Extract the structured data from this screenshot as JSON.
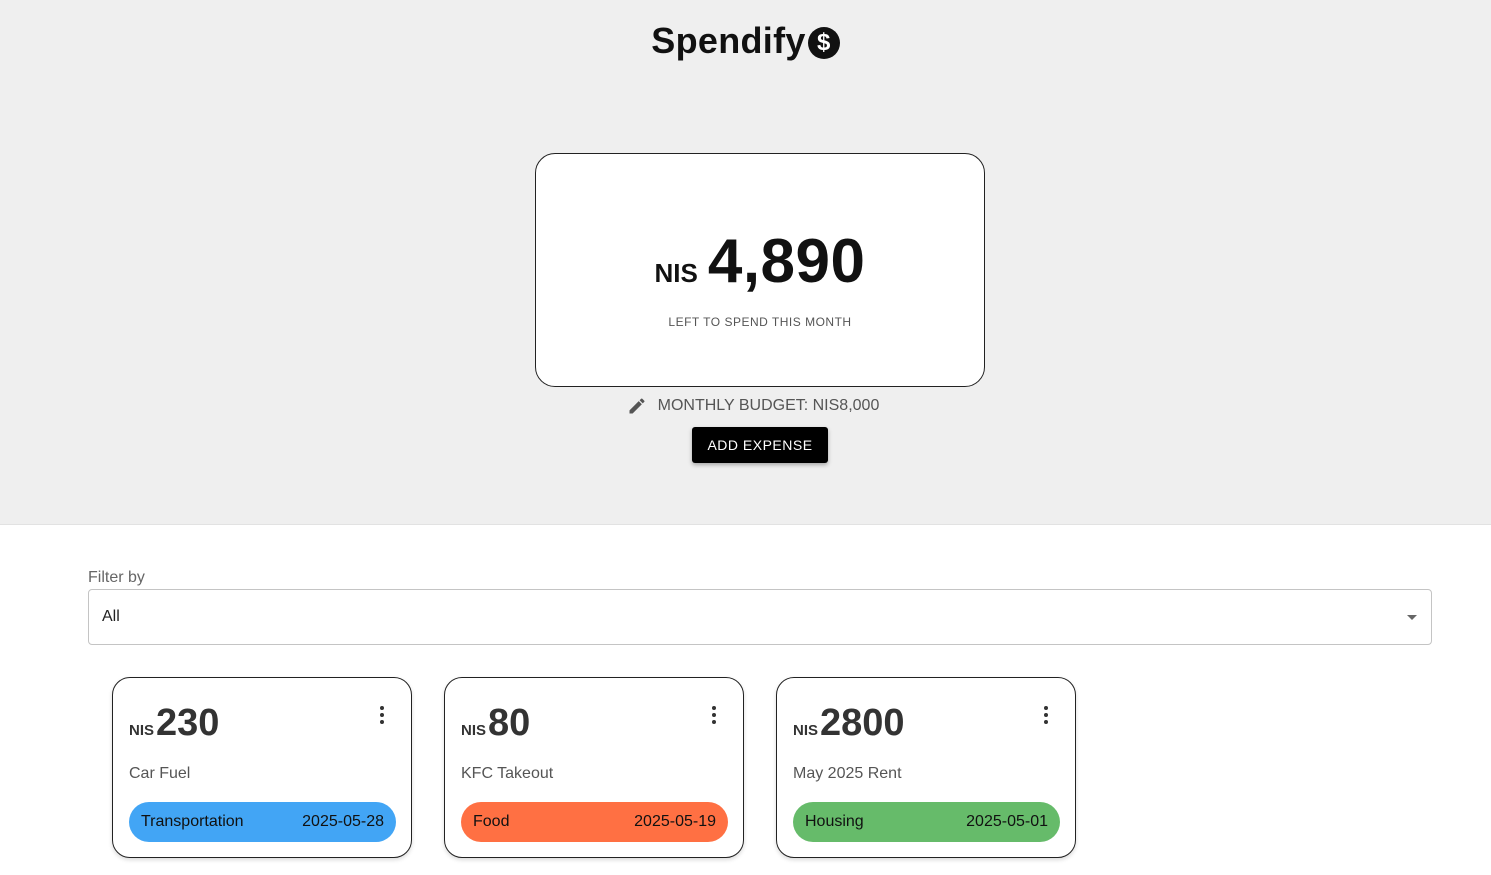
{
  "app": {
    "title": "Spendify",
    "logo_icon": "dollar-circle-icon"
  },
  "balance": {
    "currency": "NIS",
    "amount": "4,890",
    "caption": "LEFT TO SPEND THIS MONTH"
  },
  "budget": {
    "edit_icon": "pencil-icon",
    "label": "MONTHLY BUDGET: NIS8,000"
  },
  "actions": {
    "add_expense": "ADD EXPENSE"
  },
  "filter": {
    "label": "Filter by",
    "selected": "All",
    "icon": "chevron-down-icon"
  },
  "expenses": [
    {
      "currency": "NIS",
      "amount": "230",
      "description": "Car Fuel",
      "category": "Transportation",
      "date": "2025-05-28",
      "color": "#42a5f5"
    },
    {
      "currency": "NIS",
      "amount": "80",
      "description": "KFC Takeout",
      "category": "Food",
      "date": "2025-05-19",
      "color": "#ff7043"
    },
    {
      "currency": "NIS",
      "amount": "2800",
      "description": "May 2025 Rent",
      "category": "Housing",
      "date": "2025-05-01",
      "color": "#66bb6a"
    }
  ]
}
